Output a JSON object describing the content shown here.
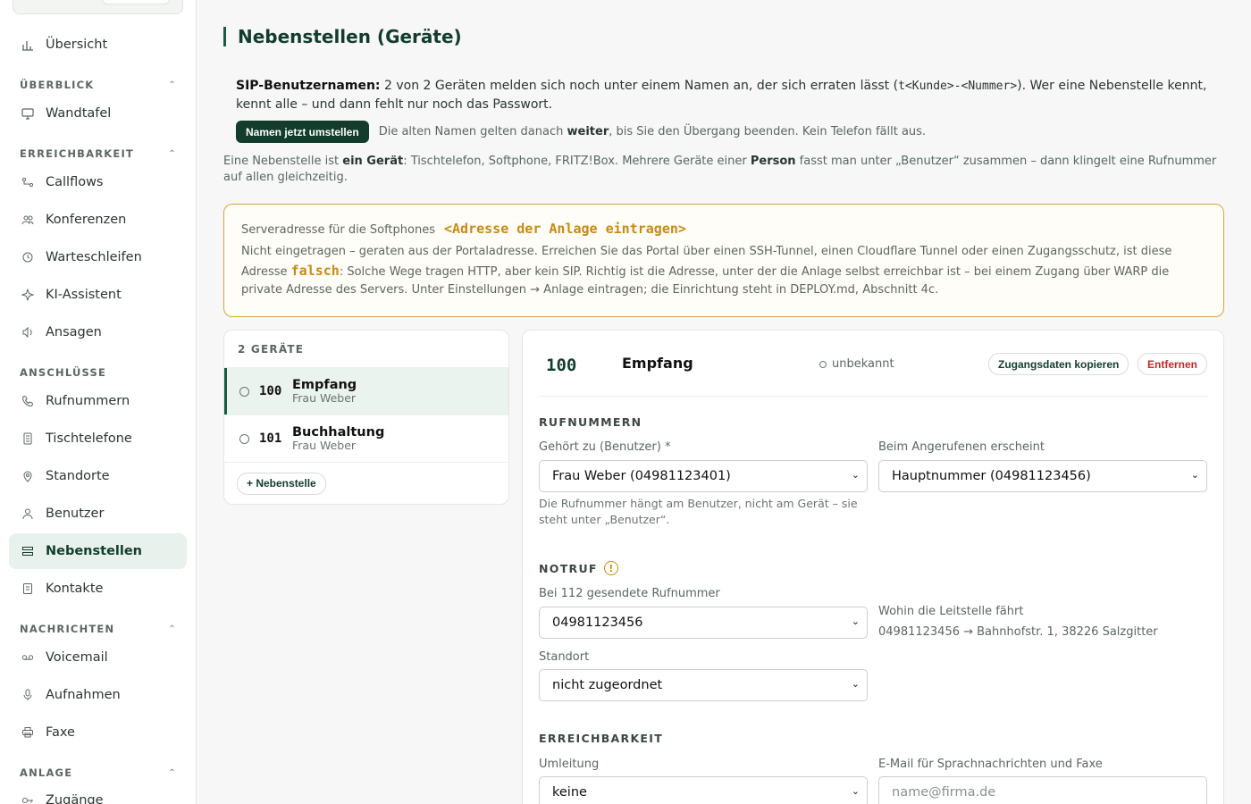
{
  "sidebar": {
    "items_top": [
      {
        "label": "Übersicht",
        "icon": "bar-chart-icon"
      }
    ],
    "sections": [
      {
        "title": "ÜBERBLICK",
        "items": [
          {
            "label": "Wandtafel",
            "icon": "monitor-icon"
          }
        ]
      },
      {
        "title": "ERREICHBARKEIT",
        "items": [
          {
            "label": "Callflows",
            "icon": "flow-icon"
          },
          {
            "label": "Konferenzen",
            "icon": "people-icon"
          },
          {
            "label": "Warteschleifen",
            "icon": "clock-icon"
          },
          {
            "label": "KI-Assistent",
            "icon": "sparkle-icon"
          },
          {
            "label": "Ansagen",
            "icon": "speaker-icon"
          }
        ]
      },
      {
        "title": "ANSCHLÜSSE",
        "items": [
          {
            "label": "Rufnummern",
            "icon": "phone-icon"
          },
          {
            "label": "Tischtelefone",
            "icon": "desk-phone-icon"
          },
          {
            "label": "Standorte",
            "icon": "location-pin-icon"
          },
          {
            "label": "Benutzer",
            "icon": "user-icon"
          },
          {
            "label": "Nebenstellen",
            "icon": "list-icon",
            "active": true
          },
          {
            "label": "Kontakte",
            "icon": "contacts-icon"
          }
        ]
      },
      {
        "title": "NACHRICHTEN",
        "items": [
          {
            "label": "Voicemail",
            "icon": "voicemail-icon"
          },
          {
            "label": "Aufnahmen",
            "icon": "microphone-icon"
          },
          {
            "label": "Faxe",
            "icon": "printer-icon"
          }
        ]
      },
      {
        "title": "ANLAGE",
        "items": [
          {
            "label": "Zugänge",
            "icon": "key-icon"
          }
        ]
      }
    ]
  },
  "page": {
    "title": "Nebenstellen (Geräte)"
  },
  "sip_notice": {
    "label": "SIP-Benutzernamen:",
    "text_1": " 2 von 2 Geräten melden sich noch unter einem Namen an, der sich erraten lässt (",
    "pattern": "t<Kunde>-<Nummer>",
    "text_2": "). Wer eine Nebenstelle kennt, kennt alle – und dann fehlt nur noch das Passwort.",
    "button": "Namen jetzt umstellen",
    "note_1": "Die alten Namen gelten danach ",
    "note_bold": "weiter",
    "note_2": ", bis Sie den Übergang beenden. Kein Telefon fällt aus."
  },
  "intro": {
    "t1": "Eine Nebenstelle ist ",
    "b1": "ein Gerät",
    "t2": ": Tischtelefon, Softphone, FRITZ!Box. Mehrere Geräte einer ",
    "b2": "Person",
    "t3": " fasst man unter „Benutzer“ zusammen – dann klingelt eine Rufnummer auf allen gleichzeitig."
  },
  "server_warning": {
    "label": "Serveradresse für die Softphones",
    "address": "<Adresse der Anlage eintragen>",
    "t1": "Nicht eingetragen – geraten aus der Portaladresse. Erreichen Sie das Portal über einen SSH-Tunnel, einen Cloudflare Tunnel oder einen Zugangsschutz, ist diese Adresse ",
    "falsch": "falsch",
    "t2": ": Solche Wege tragen HTTP, aber kein SIP. Richtig ist die Adresse, unter der die Anlage selbst erreichbar ist – bei einem Zugang über WARP die private Adresse des Servers. Unter Einstellungen → Anlage eintragen; die Einrichtung steht in DEPLOY.md, Abschnitt 4c."
  },
  "devices": {
    "header": "2 GERÄTE",
    "items": [
      {
        "number": "100",
        "name": "Empfang",
        "user": "Frau Weber",
        "selected": true
      },
      {
        "number": "101",
        "name": "Buchhaltung",
        "user": "Frau Weber",
        "selected": false
      }
    ],
    "add_button": "+ Nebenstelle"
  },
  "detail": {
    "number": "100",
    "name": "Empfang",
    "status": "unbekannt",
    "copy_button": "Zugangsdaten kopieren",
    "remove_button": "Entfernen",
    "rufnummern": {
      "section": "RUFNUMMERN",
      "user_label": "Gehört zu (Benutzer) *",
      "user_value": "Frau Weber (04981123401)",
      "user_help": "Die Rufnummer hängt am Benutzer, nicht am Gerät – sie steht unter „Benutzer“.",
      "caller_label": "Beim Angerufenen erscheint",
      "caller_value": "Hauptnummer (04981123456)"
    },
    "notruf": {
      "section": "NOTRUF",
      "number_label": "Bei 112 gesendete Rufnummer",
      "number_value": "04981123456",
      "dest_label": "Wohin die Leitstelle fährt",
      "dest_value": "04981123456 → Bahnhofstr. 1, 38226 Salzgitter",
      "location_label": "Standort",
      "location_value": "nicht zugeordnet"
    },
    "erreichbarkeit": {
      "section": "ERREICHBARKEIT",
      "forward_label": "Umleitung",
      "forward_value": "keine",
      "email_label": "E-Mail für Sprachnachrichten und Faxe",
      "email_placeholder": "name@firma.de"
    }
  }
}
